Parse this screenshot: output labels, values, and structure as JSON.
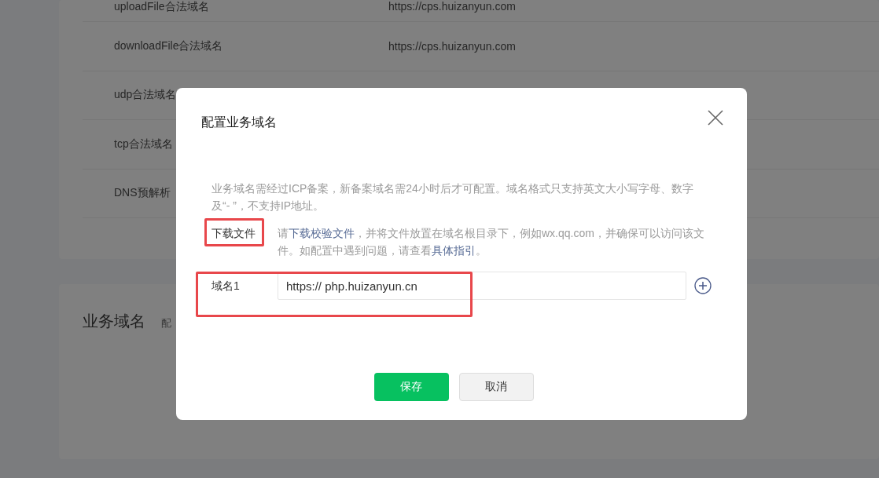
{
  "background": {
    "rows": [
      {
        "name": "uploadFile合法域名",
        "value": "https://cps.huizanyun.com"
      },
      {
        "name": "downloadFile合法域名",
        "value": "https://cps.huizanyun.com"
      },
      {
        "name": "udp合法域名"
      },
      {
        "name": "tcp合法域名"
      },
      {
        "name": "DNS预解析"
      }
    ],
    "section_title": "业务域名",
    "section_note": "配"
  },
  "dialog": {
    "title": "配置业务域名",
    "notice": "业务域名需经过ICP备案，新备案域名需24小时后才可配置。域名格式只支持英文大小写字母、数字及“- ”，不支持IP地址。",
    "download": {
      "label": "下载文件",
      "parts": [
        {
          "kind": "text",
          "text": "请"
        },
        {
          "kind": "link",
          "text": "下载校验文件"
        },
        {
          "kind": "text",
          "text": "，并将文件放置在域名根目录下，例如wx.qq.com，并确保可以访问该文件。如配置中遇到问题，请查看"
        },
        {
          "kind": "link",
          "text": "具体指引"
        },
        {
          "kind": "text",
          "text": "。"
        }
      ]
    },
    "field": {
      "label": "域名1",
      "value": "https:// php.huizanyun.cn"
    },
    "buttons": [
      {
        "label": "保存",
        "kind": "primary"
      },
      {
        "label": "取消",
        "kind": "default"
      }
    ]
  },
  "annotations": [
    {
      "kind": "rectangle"
    },
    {
      "kind": "rectangle"
    }
  ]
}
